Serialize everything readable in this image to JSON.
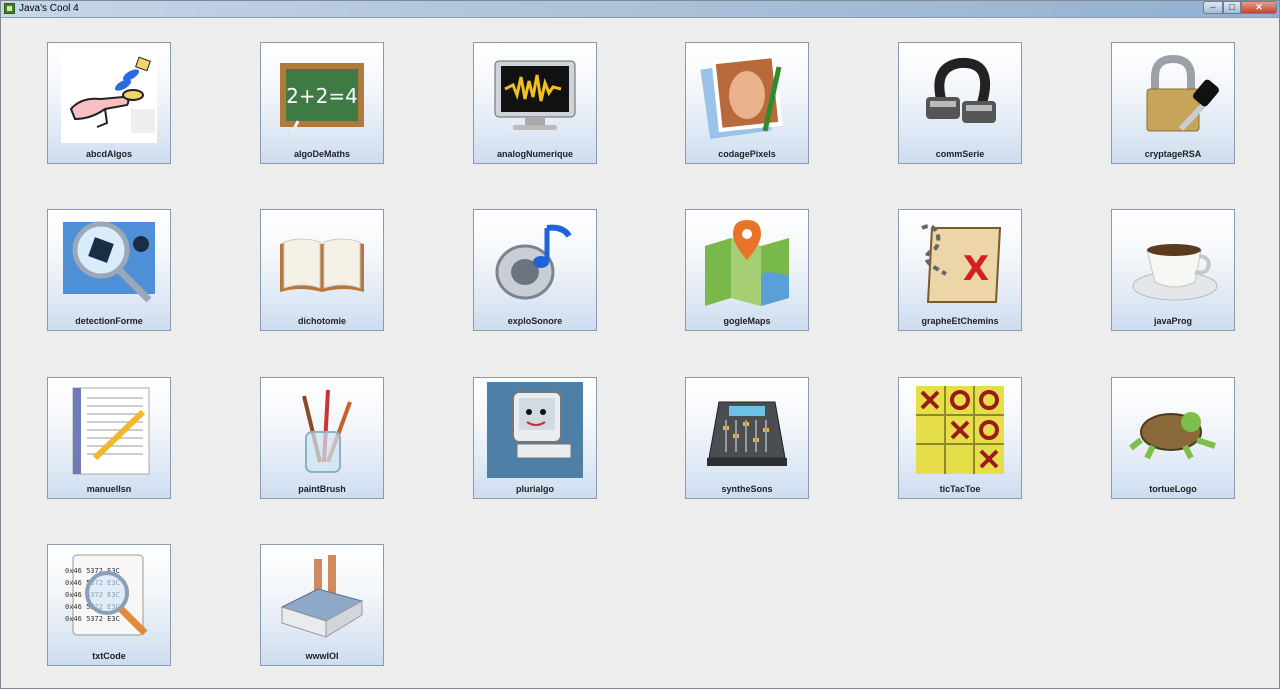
{
  "window": {
    "title": "Java's Cool 4",
    "minimize": "–",
    "maximize": "□",
    "close": "✕"
  },
  "tiles": [
    {
      "label": "abcdAlgos",
      "icon": "hand-pointing-icon"
    },
    {
      "label": "algoDeMaths",
      "icon": "chalkboard-icon"
    },
    {
      "label": "analogNumerique",
      "icon": "monitor-waveform-icon"
    },
    {
      "label": "codagePixels",
      "icon": "portrait-pencil-icon"
    },
    {
      "label": "commSerie",
      "icon": "serial-cable-icon"
    },
    {
      "label": "cryptageRSA",
      "icon": "padlock-key-icon"
    },
    {
      "label": "detectionForme",
      "icon": "magnifier-shapes-icon"
    },
    {
      "label": "dichotomie",
      "icon": "open-book-icon"
    },
    {
      "label": "exploSonore",
      "icon": "speaker-note-icon"
    },
    {
      "label": "gogleMaps",
      "icon": "map-pin-icon"
    },
    {
      "label": "grapheEtChemins",
      "icon": "treasure-map-icon"
    },
    {
      "label": "javaProg",
      "icon": "coffee-cup-icon"
    },
    {
      "label": "manuelIsn",
      "icon": "document-pencil-icon"
    },
    {
      "label": "paintBrush",
      "icon": "brushes-jar-icon"
    },
    {
      "label": "plurialgo",
      "icon": "computer-character-icon"
    },
    {
      "label": "syntheSons",
      "icon": "mixing-console-icon"
    },
    {
      "label": "ticTacToe",
      "icon": "tictactoe-board-icon"
    },
    {
      "label": "tortueLogo",
      "icon": "turtle-icon"
    },
    {
      "label": "txtCode",
      "icon": "text-magnifier-icon"
    },
    {
      "label": "wwwIOI",
      "icon": "factory-icon"
    }
  ],
  "text_snippets": {
    "code_line": "0x46 5372 E3C",
    "map_marker": "X"
  }
}
